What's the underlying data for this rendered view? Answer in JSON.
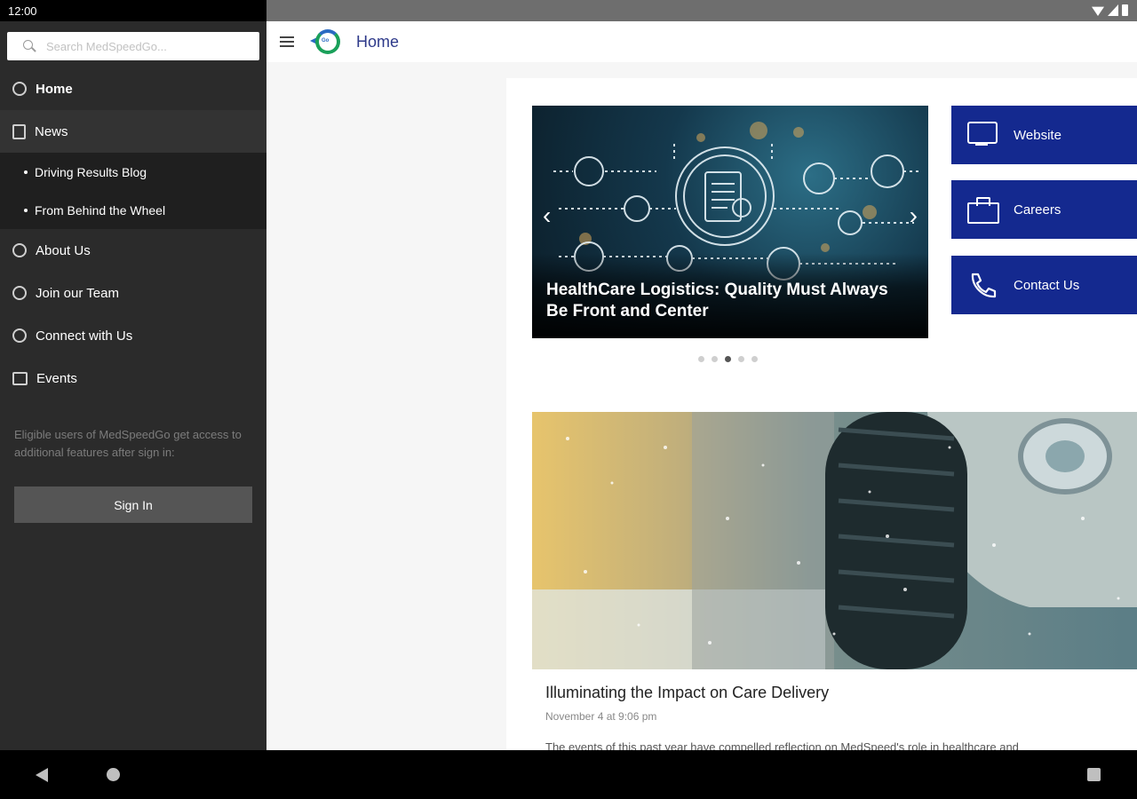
{
  "status": {
    "time": "12:00"
  },
  "drawer": {
    "search_placeholder": "Search MedSpeedGo...",
    "items": [
      {
        "label": "Home",
        "icon": "compass-icon"
      },
      {
        "label": "News",
        "icon": "document-icon"
      },
      {
        "label": "Driving Results Blog",
        "icon": "bullet"
      },
      {
        "label": "From Behind the Wheel",
        "icon": "bullet"
      },
      {
        "label": "About Us",
        "icon": "compass-icon"
      },
      {
        "label": "Join our Team",
        "icon": "compass-icon"
      },
      {
        "label": "Connect with Us",
        "icon": "compass-icon"
      },
      {
        "label": "Events",
        "icon": "calendar-icon"
      }
    ],
    "note": "Eligible users of MedSpeedGo get access to additional features after sign in:",
    "signin_label": "Sign In"
  },
  "appbar": {
    "title": "Home"
  },
  "carousel": {
    "caption": "HealthCare Logistics: Quality Must Always Be Front and Center",
    "slide_count": 5,
    "active_index": 2
  },
  "quick_links": [
    {
      "label": "Website",
      "icon": "monitor-icon"
    },
    {
      "label": "Careers",
      "icon": "briefcase-icon"
    },
    {
      "label": "Contact Us",
      "icon": "phone-icon"
    }
  ],
  "article": {
    "title": "Illuminating the Impact on Care Delivery",
    "date": "November 4 at 9:06 pm",
    "snippet": "The events of this past year have compelled reflection on MedSpeed's role in healthcare and"
  },
  "colors": {
    "brand_blue": "#14298f",
    "drawer_bg": "#2b2b2b",
    "title_blue": "#2e3a8a"
  }
}
